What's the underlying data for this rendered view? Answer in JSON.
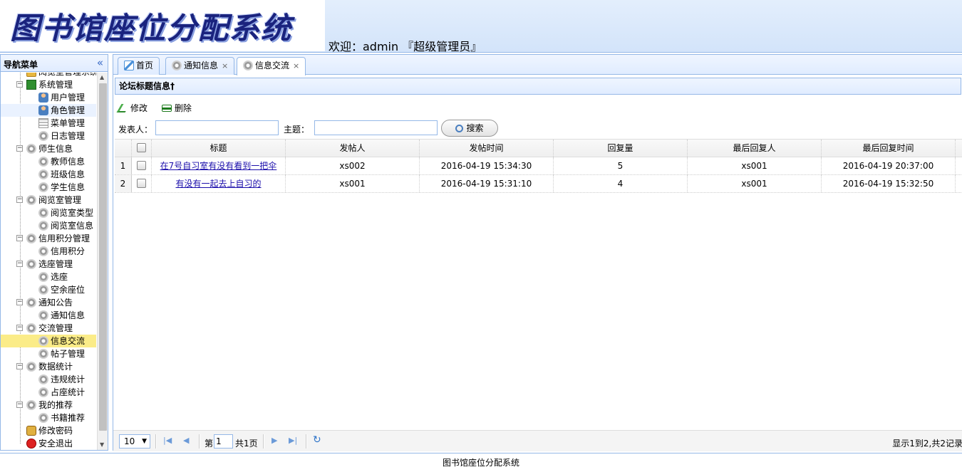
{
  "header": {
    "logo_text": "图书馆座位分配系统",
    "welcome": "欢迎：admin 『超级管理员』"
  },
  "nav": {
    "title": "导航菜单",
    "collapse_icon": "double-chevron-left-icon",
    "top_partial_label": "阅览室管理系统",
    "groups": [
      {
        "label": "系统管理",
        "items": [
          "用户管理",
          "角色管理",
          "菜单管理",
          "日志管理"
        ]
      },
      {
        "label": "师生信息",
        "items": [
          "教师信息",
          "班级信息",
          "学生信息"
        ]
      },
      {
        "label": "阅览室管理",
        "items": [
          "阅览室类型",
          "阅览室信息"
        ]
      },
      {
        "label": "信用积分管理",
        "items": [
          "信用积分"
        ]
      },
      {
        "label": "选座管理",
        "items": [
          "选座",
          "空余座位"
        ]
      },
      {
        "label": "通知公告",
        "items": [
          "通知信息"
        ]
      },
      {
        "label": "交流管理",
        "items": [
          "信息交流",
          "帖子管理"
        ]
      },
      {
        "label": "数据统计",
        "items": [
          "违规统计",
          "占座统计"
        ]
      },
      {
        "label": "我的推荐",
        "items": [
          "书籍推荐"
        ]
      }
    ],
    "bottom_items": [
      "修改密码",
      "安全退出"
    ],
    "selected_item": "信息交流",
    "hover_item": "角色管理"
  },
  "tabs": [
    {
      "label": "首页",
      "icon": "home-icon",
      "closable": false
    },
    {
      "label": "通知信息",
      "icon": "gear-icon",
      "closable": true
    },
    {
      "label": "信息交流",
      "icon": "gear-icon",
      "closable": true,
      "active": true
    }
  ],
  "tab_close_glyph": "×",
  "panel": {
    "title": "论坛标题信息†",
    "toolbar": {
      "edit_label": "修改",
      "delete_label": "删除"
    },
    "search": {
      "poster_label": "发表人：",
      "poster_value": "",
      "subject_label": "主题：",
      "subject_value": "",
      "button_label": "搜索"
    }
  },
  "grid": {
    "columns": [
      "标题",
      "发帖人",
      "发帖时间",
      "回复量",
      "最后回复人",
      "最后回复时间"
    ],
    "rows": [
      {
        "num": "1",
        "title": "在7号自习室有没有看到一把伞",
        "poster": "xs002",
        "post_time": "2016-04-19 15:34:30",
        "replies": "5",
        "last_replier": "xs001",
        "last_reply_time": "2016-04-19 20:37:00"
      },
      {
        "num": "2",
        "title": "有没有一起去上自习的",
        "poster": "xs001",
        "post_time": "2016-04-19 15:31:10",
        "replies": "4",
        "last_replier": "xs001",
        "last_reply_time": "2016-04-19 15:32:50"
      }
    ]
  },
  "pager": {
    "page_size": "10",
    "page_label": "第",
    "page_value": "1",
    "page_total": "共1页",
    "info": "显示1到2,共2记录"
  },
  "footer": {
    "text": "图书馆座位分配系统"
  }
}
